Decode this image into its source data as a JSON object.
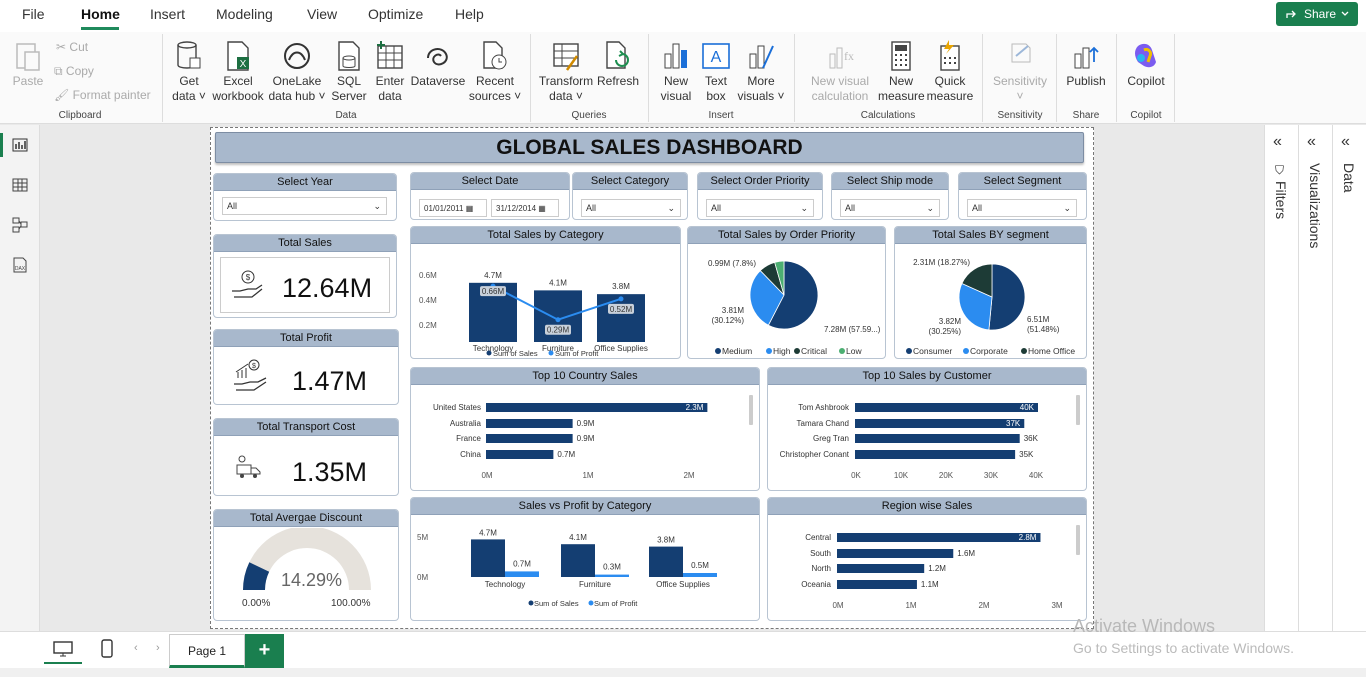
{
  "menu": {
    "file": "File",
    "home": "Home",
    "insert": "Insert",
    "modeling": "Modeling",
    "view": "View",
    "optimize": "Optimize",
    "help": "Help",
    "share": "Share"
  },
  "ribbon": {
    "clipboard": {
      "paste": "Paste",
      "cut": "Cut",
      "copy": "Copy",
      "format_painter": "Format painter",
      "group": "Clipboard"
    },
    "data": {
      "get_data": [
        "Get",
        "data"
      ],
      "excel": [
        "Excel",
        "workbook"
      ],
      "onelake": [
        "OneLake",
        "data hub"
      ],
      "sql": [
        "SQL",
        "Server"
      ],
      "enter": [
        "Enter",
        "data"
      ],
      "dataverse": "Dataverse",
      "recent": [
        "Recent",
        "sources"
      ],
      "group": "Data"
    },
    "queries": {
      "transform": [
        "Transform",
        "data"
      ],
      "refresh": "Refresh",
      "group": "Queries"
    },
    "insert": {
      "new_visual": [
        "New",
        "visual"
      ],
      "text_box": [
        "Text",
        "box"
      ],
      "more_visuals": [
        "More",
        "visuals"
      ],
      "group": "Insert"
    },
    "calculations": {
      "new_visual_calc": [
        "New visual",
        "calculation"
      ],
      "new_measure": [
        "New",
        "measure"
      ],
      "quick_measure": [
        "Quick",
        "measure"
      ],
      "group": "Calculations"
    },
    "sensitivity": {
      "label": "Sensitivity",
      "group": "Sensitivity"
    },
    "share": {
      "publish": "Publish",
      "group": "Share"
    },
    "copilot": {
      "label": "Copilot",
      "group": "Copilot"
    }
  },
  "dashboard": {
    "title": "GLOBAL SALES DASHBOARD",
    "slicers": {
      "year": {
        "label": "Select Year",
        "value": "All"
      },
      "date": {
        "label": "Select Date",
        "from": "01/01/2011",
        "to": "31/12/2014"
      },
      "category": {
        "label": "Select Category",
        "value": "All"
      },
      "order_priority": {
        "label": "Select Order Priority",
        "value": "All"
      },
      "ship_mode": {
        "label": "Select Ship mode",
        "value": "All"
      },
      "segment": {
        "label": "Select Segment",
        "value": "All"
      }
    },
    "kpis": {
      "sales": {
        "label": "Total Sales",
        "value": "12.64M"
      },
      "profit": {
        "label": "Total Profit",
        "value": "1.47M"
      },
      "transport": {
        "label": "Total Transport Cost",
        "value": "1.35M"
      },
      "discount": {
        "label": "Total Avergae Discount",
        "value": "14.29%",
        "min": "0.00%",
        "max": "100.00%",
        "fraction": 0.1429
      }
    }
  },
  "chart_data": [
    {
      "type": "bar",
      "title": "Total Sales by Category",
      "categories": [
        "Technology",
        "Furniture",
        "Office Supplies"
      ],
      "series": [
        {
          "name": "Sum of Sales",
          "values": [
            4.7,
            4.1,
            3.8
          ],
          "labels": [
            "4.7M",
            "4.1M",
            "3.8M"
          ]
        },
        {
          "name": "Sum of Profit",
          "values": [
            0.66,
            0.29,
            0.52
          ],
          "labels": [
            "0.66M",
            "0.29M",
            "0.52M"
          ]
        }
      ],
      "y_ticks": [
        "0.6M",
        "0.4M",
        "0.2M"
      ]
    },
    {
      "type": "pie",
      "title": "Total Sales by Order Priority",
      "slices": [
        {
          "name": "Medium",
          "value": 7.28,
          "label": "7.28M (57.59...)",
          "color": "#143e72"
        },
        {
          "name": "High",
          "value": 3.81,
          "label": "3.81M (30.12%)",
          "color": "#2b8cf0"
        },
        {
          "name": "Critical",
          "value": 0.99,
          "label": "0.99M (7.8%)",
          "color": "#1d3b36"
        },
        {
          "name": "Low",
          "value": 0.56,
          "label": "",
          "color": "#4caf72"
        }
      ]
    },
    {
      "type": "pie",
      "title": "Total Sales BY segment",
      "slices": [
        {
          "name": "Consumer",
          "value": 6.51,
          "label": "6.51M (51.48%)",
          "color": "#143e72"
        },
        {
          "name": "Corporate",
          "value": 3.82,
          "label": "3.82M (30.25%)",
          "color": "#2b8cf0"
        },
        {
          "name": "Home Office",
          "value": 2.31,
          "label": "2.31M (18.27%)",
          "color": "#1d3b36"
        }
      ]
    },
    {
      "type": "bar",
      "orientation": "horizontal",
      "title": "Top 10 Country Sales",
      "categories": [
        "United States",
        "Australia",
        "France",
        "China"
      ],
      "values": [
        2.3,
        0.9,
        0.9,
        0.7
      ],
      "labels": [
        "2.3M",
        "0.9M",
        "0.9M",
        "0.7M"
      ],
      "x_ticks": [
        "0M",
        "1M",
        "2M"
      ],
      "xlim": [
        0,
        2.4
      ]
    },
    {
      "type": "bar",
      "orientation": "horizontal",
      "title": "Top 10 Sales by Customer",
      "categories": [
        "Tom Ashbrook",
        "Tamara Chand",
        "Greg Tran",
        "Christopher Conant"
      ],
      "values": [
        40,
        37,
        36,
        35
      ],
      "labels": [
        "40K",
        "37K",
        "36K",
        "35K"
      ],
      "x_ticks": [
        "0K",
        "10K",
        "20K",
        "30K",
        "40K"
      ],
      "xlim": [
        0,
        40
      ]
    },
    {
      "type": "bar",
      "title": "Sales vs Profit by Category",
      "categories": [
        "Technology",
        "Furniture",
        "Office Supplies"
      ],
      "series": [
        {
          "name": "Sum of Sales",
          "values": [
            4.7,
            4.1,
            3.8
          ],
          "labels": [
            "4.7M",
            "4.1M",
            "3.8M"
          ]
        },
        {
          "name": "Sum of Profit",
          "values": [
            0.7,
            0.3,
            0.5
          ],
          "labels": [
            "0.7M",
            "0.3M",
            "0.5M"
          ]
        }
      ],
      "y_ticks": [
        "5M",
        "0M"
      ]
    },
    {
      "type": "bar",
      "orientation": "horizontal",
      "title": "Region wise Sales",
      "categories": [
        "Central",
        "South",
        "North",
        "Oceania"
      ],
      "values": [
        2.8,
        1.6,
        1.2,
        1.1
      ],
      "labels": [
        "2.8M",
        "1.6M",
        "1.2M",
        "1.1M"
      ],
      "x_ticks": [
        "0M",
        "1M",
        "2M",
        "3M"
      ],
      "xlim": [
        0,
        3
      ]
    }
  ],
  "bottom": {
    "page_tab": "Page 1",
    "add": "+"
  },
  "panes": {
    "filters": "Filters",
    "visualizations": "Visualizations",
    "data": "Data"
  },
  "watermark": {
    "line1": "Activate Windows",
    "line2": "Go to Settings to activate Windows."
  }
}
